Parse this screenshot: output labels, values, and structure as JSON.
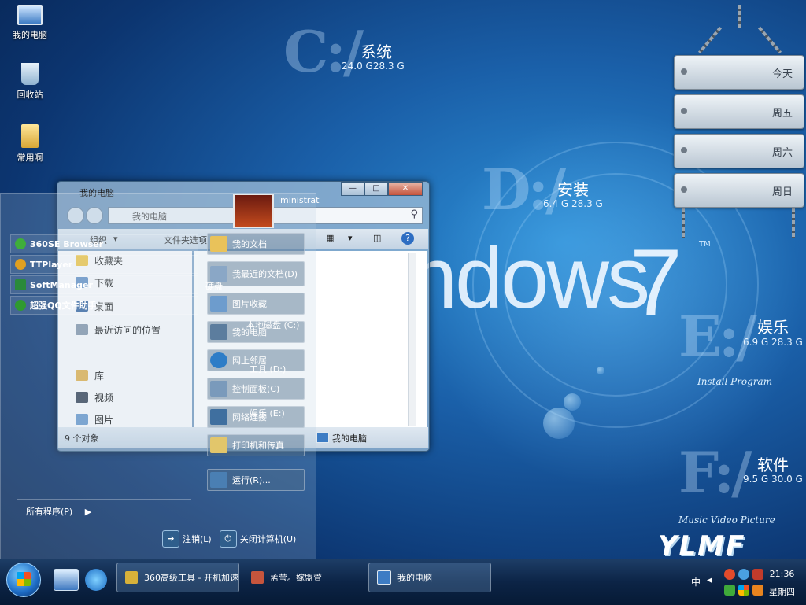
{
  "desktop": {
    "icons": [
      {
        "label": "我的电脑"
      },
      {
        "label": "回收站"
      },
      {
        "label": "常用啊"
      }
    ],
    "windows7_text": "ndows",
    "windows7_seven": "7",
    "trademark": "TM",
    "drives": [
      {
        "letter": "C:/",
        "name": "系统",
        "size": "24.0 G28.3 G"
      },
      {
        "letter": "D:/",
        "name": "安装",
        "size": "6.4 G 28.3 G"
      },
      {
        "letter": "E:/",
        "name": "娱乐",
        "size": "6.9 G 28.3 G"
      },
      {
        "letter": "F:/",
        "name": "软件",
        "size": "9.5 G 30.0 G"
      }
    ],
    "captions": {
      "install": "Install Program",
      "music": "Music Video Picture"
    },
    "calendar": [
      "今天",
      "周五",
      "周六",
      "周日"
    ],
    "logo": "YLMF"
  },
  "start_menu": {
    "user_name": "lministrat",
    "pinned": [
      {
        "label": "360SE Browser",
        "color": "#3fae3a"
      },
      {
        "label": "TTPlayer",
        "color": "#e0a020"
      },
      {
        "label": "SoftManager",
        "color": "#2a8a3a"
      },
      {
        "label": "超强QQ文件助手",
        "color": "#2f9a2f"
      }
    ],
    "all_programs": "所有程序(P)",
    "right_items": [
      {
        "label": "我的文档"
      },
      {
        "label": "我最近的文档(D)"
      },
      {
        "label": "图片收藏"
      },
      {
        "label": "我的电脑"
      },
      {
        "label": "网上邻居"
      },
      {
        "label": "控制面板(C)"
      },
      {
        "label": "网络连接"
      },
      {
        "label": "打印机和传真"
      }
    ],
    "run": "运行(R)...",
    "drive_labels": {
      "header": "硬盘",
      "c": "本地磁盘 (C:)",
      "d": "工具 (D:)",
      "e": "娱乐 (E:)"
    },
    "logoff": "注销(L)",
    "shutdown": "关闭计算机(U)"
  },
  "explorer": {
    "title": "我的电脑",
    "address": "我的电脑",
    "toolbar": {
      "organize": "组织",
      "options": "文件夹选项"
    },
    "nav": [
      {
        "label": "收藏夹"
      },
      {
        "label": "下载"
      },
      {
        "label": "桌面"
      },
      {
        "label": "最近访问的位置"
      },
      {
        "label": "库"
      },
      {
        "label": "视频"
      },
      {
        "label": "图片"
      }
    ],
    "status": "9 个对象",
    "status_location": "我的电脑"
  },
  "taskbar": {
    "buttons": [
      {
        "label": "360高级工具 - 开机加速"
      },
      {
        "label": "孟莹。嫁盟萱"
      },
      {
        "label": "我的电脑"
      }
    ],
    "ime": "中",
    "time": "21:36",
    "day": "星期四"
  }
}
